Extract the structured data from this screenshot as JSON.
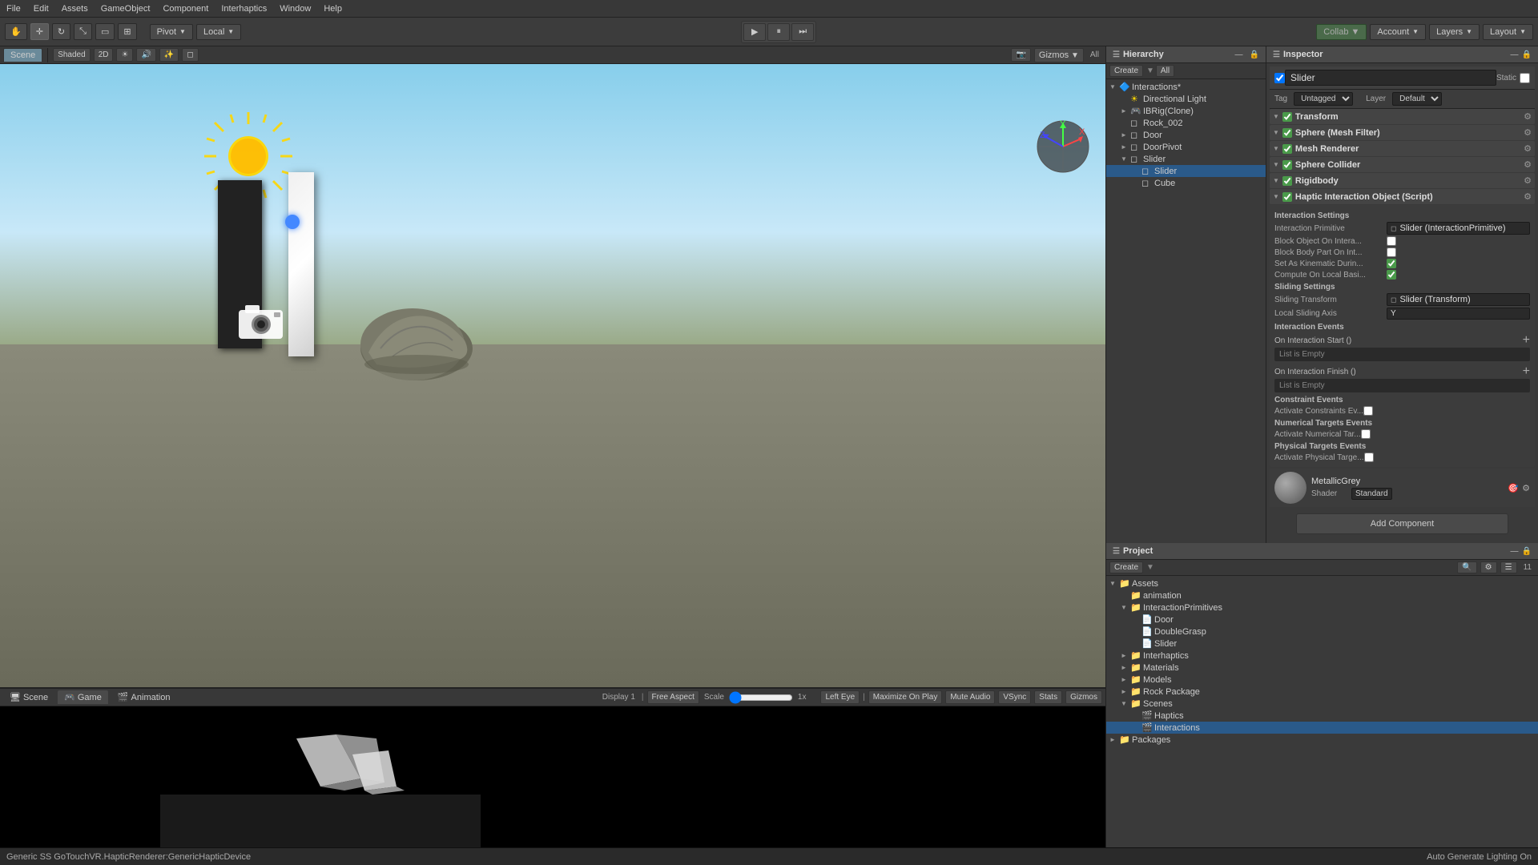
{
  "menuBar": {
    "items": [
      "File",
      "Edit",
      "Assets",
      "GameObject",
      "Component",
      "Interhaptics",
      "Window",
      "Help"
    ]
  },
  "toolbar": {
    "tools": [
      "hand",
      "move",
      "rotate",
      "scale",
      "rect",
      "transform"
    ],
    "pivotLabel": "Pivot",
    "localLabel": "Local",
    "playBtn": "▶",
    "pauseBtn": "⏸",
    "stepBtn": "⏭",
    "collabLabel": "Collab ▼",
    "accountLabel": "Account",
    "layersLabel": "Layers",
    "layoutLabel": "Layout"
  },
  "sceneView": {
    "tabs": [
      "Scene",
      "Game",
      "Animation"
    ],
    "activeTab": "Scene",
    "shading": "Shaded",
    "twod": "2D",
    "gizmosLabel": "Gizmos",
    "allLabel": "All"
  },
  "hierarchy": {
    "title": "Hierarchy",
    "createBtn": "Create",
    "allBtn": "All",
    "items": [
      {
        "id": "interactions",
        "label": "Interactions*",
        "depth": 0,
        "arrow": "▼",
        "icon": "🔷"
      },
      {
        "id": "directional-light",
        "label": "Directional Light",
        "depth": 1,
        "arrow": "",
        "icon": "💡"
      },
      {
        "id": "ibrig-clone",
        "label": "IBRig(Clone)",
        "depth": 1,
        "arrow": "►",
        "icon": "🎮"
      },
      {
        "id": "rock-002",
        "label": "Rock_002",
        "depth": 1,
        "arrow": "",
        "icon": "◻"
      },
      {
        "id": "door",
        "label": "Door",
        "depth": 1,
        "arrow": "►",
        "icon": "◻"
      },
      {
        "id": "doorpivot",
        "label": "DoorPivot",
        "depth": 1,
        "arrow": "►",
        "icon": "◻"
      },
      {
        "id": "slider",
        "label": "Slider",
        "depth": 1,
        "arrow": "▼",
        "icon": "◻"
      },
      {
        "id": "slider-sel",
        "label": "Slider",
        "depth": 2,
        "arrow": "",
        "icon": "◻",
        "selected": true
      },
      {
        "id": "cube",
        "label": "Cube",
        "depth": 2,
        "arrow": "",
        "icon": "◻"
      }
    ]
  },
  "inspector": {
    "title": "Inspector",
    "objectName": "Slider",
    "staticLabel": "Static",
    "tagLabel": "Tag",
    "tagValue": "Untagged",
    "layerLabel": "Layer",
    "layerValue": "Default",
    "components": [
      {
        "id": "transform",
        "name": "Transform",
        "enabled": true,
        "fields": []
      },
      {
        "id": "sphere-mesh-filter",
        "name": "Sphere (Mesh Filter)",
        "enabled": true,
        "fields": []
      },
      {
        "id": "mesh-renderer",
        "name": "Mesh Renderer",
        "enabled": true,
        "fields": []
      },
      {
        "id": "sphere-collider",
        "name": "Sphere Collider",
        "enabled": true,
        "fields": []
      },
      {
        "id": "rigidbody",
        "name": "Rigidbody",
        "enabled": true,
        "fields": []
      },
      {
        "id": "haptic-interaction",
        "name": "Haptic Interaction Object (Script)",
        "enabled": true,
        "fields": []
      }
    ],
    "interactionSettings": {
      "title": "Interaction Settings",
      "primLabel": "Interaction Primitive",
      "primValue": "Slider (InteractionPrimitive)",
      "blockObjLabel": "Block Object On Intera...",
      "blockObjValue": false,
      "blockBodyLabel": "Block Body Part On Int...",
      "blockBodyValue": false,
      "setKinematicLabel": "Set As Kinematic Durin...",
      "setKinematicValue": true,
      "computeLocalLabel": "Compute On Local Basi...",
      "computeLocalValue": true
    },
    "slidingSettings": {
      "title": "Sliding Settings",
      "transformLabel": "Sliding Transform",
      "transformValue": "Slider (Transform)",
      "axisLabel": "Local Sliding Axis",
      "axisValue": "Y"
    },
    "interactionEvents": {
      "title": "Interaction Events",
      "startLabel": "On Interaction Start ()",
      "startEmpty": "List is Empty",
      "finishLabel": "On Interaction Finish ()",
      "finishEmpty": "List is Empty"
    },
    "constraintEvents": {
      "title": "Constraint Events",
      "activateLabel": "Activate Constraints Ev..."
    },
    "numericalTargets": {
      "title": "Numerical Targets Events",
      "activateLabel": "Activate Numerical Tar..."
    },
    "physicalTargets": {
      "title": "Physical Targets Events",
      "activateLabel": "Activate Physical Targe..."
    },
    "material": {
      "name": "MetallicGrey",
      "shaderLabel": "Shader",
      "shaderValue": "Standard"
    },
    "addComponentBtn": "Add Component"
  },
  "project": {
    "title": "Project",
    "createBtn": "Create",
    "items": [
      {
        "id": "assets",
        "label": "Assets",
        "depth": 0,
        "arrow": "▼",
        "icon": "📁"
      },
      {
        "id": "animation",
        "label": "animation",
        "depth": 1,
        "arrow": "",
        "icon": "📁"
      },
      {
        "id": "interactionprimitives",
        "label": "InteractionPrimitives",
        "depth": 1,
        "arrow": "▼",
        "icon": "📁"
      },
      {
        "id": "door",
        "label": "Door",
        "depth": 2,
        "arrow": "",
        "icon": "📄"
      },
      {
        "id": "doublegrasp",
        "label": "DoubleGrasp",
        "depth": 2,
        "arrow": "",
        "icon": "📄"
      },
      {
        "id": "slider-asset",
        "label": "Slider",
        "depth": 2,
        "arrow": "",
        "icon": "📄"
      },
      {
        "id": "interhaptics",
        "label": "Interhaptics",
        "depth": 1,
        "arrow": "►",
        "icon": "📁"
      },
      {
        "id": "materials",
        "label": "Materials",
        "depth": 1,
        "arrow": "►",
        "icon": "📁"
      },
      {
        "id": "models",
        "label": "Models",
        "depth": 1,
        "arrow": "►",
        "icon": "📁"
      },
      {
        "id": "rock-package",
        "label": "Rock Package",
        "depth": 1,
        "arrow": "►",
        "icon": "📁"
      },
      {
        "id": "scenes",
        "label": "Scenes",
        "depth": 1,
        "arrow": "▼",
        "icon": "📁"
      },
      {
        "id": "haptics-scene",
        "label": "Haptics",
        "depth": 2,
        "arrow": "",
        "icon": "🎬"
      },
      {
        "id": "interactions-scene",
        "label": "Interactions",
        "depth": 2,
        "arrow": "",
        "icon": "🎬",
        "selected": true
      },
      {
        "id": "packages",
        "label": "Packages",
        "depth": 0,
        "arrow": "►",
        "icon": "📁"
      }
    ]
  },
  "gameView": {
    "displayLabel": "Display 1",
    "aspectLabel": "Free Aspect",
    "scaleLabel": "Scale",
    "scaleValue": "1x",
    "leftEyeLabel": "Left Eye",
    "maximizeLabel": "Maximize On Play",
    "muteAudioLabel": "Mute Audio",
    "vsyncLabel": "VSync",
    "statsLabel": "Stats",
    "gizmosLabel": "Gizmos"
  },
  "statusBar": {
    "message": "Generic SS GoTouchVR.HapticRenderer:GenericHapticDevice",
    "autoGenLabel": "Auto Generate Lighting On"
  }
}
